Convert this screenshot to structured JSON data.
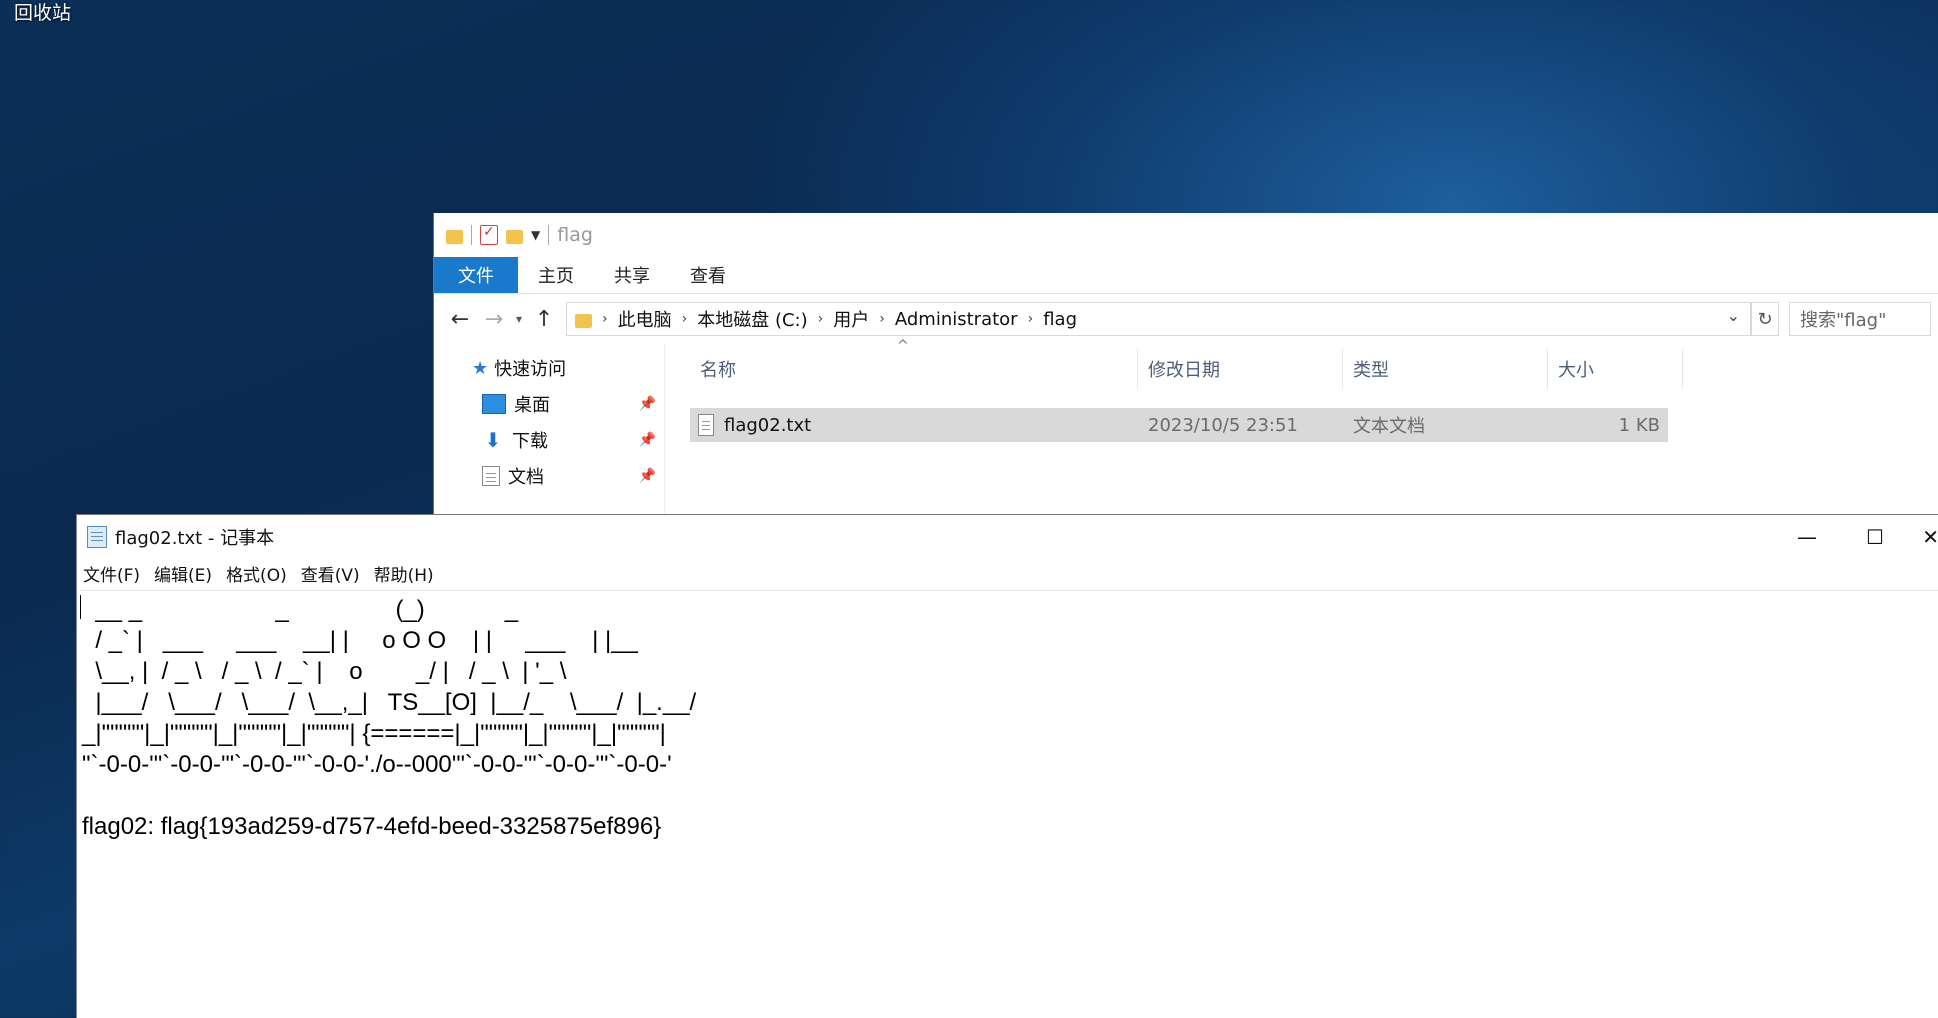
{
  "desktop": {
    "recycle_bin_label": "回收站"
  },
  "explorer": {
    "title": "flag",
    "ribbon_tabs": [
      "文件",
      "主页",
      "共享",
      "查看"
    ],
    "breadcrumbs": [
      "此电脑",
      "本地磁盘 (C:)",
      "用户",
      "Administrator",
      "flag"
    ],
    "search_placeholder": "搜索\"flag\"",
    "nav_items": [
      {
        "label": "快速访问",
        "icon": "star-icon"
      },
      {
        "label": "桌面",
        "icon": "desktop-icon"
      },
      {
        "label": "下载",
        "icon": "download-icon"
      },
      {
        "label": "文档",
        "icon": "document-icon"
      }
    ],
    "columns": [
      "名称",
      "修改日期",
      "类型",
      "大小"
    ],
    "files": [
      {
        "name": "flag02.txt",
        "modified": "2023/10/5 23:51",
        "type": "文本文档",
        "size": "1 KB"
      }
    ]
  },
  "notepad": {
    "title": "flag02.txt - 记事本",
    "menu": [
      "文件(F)",
      "编辑(E)",
      "格式(O)",
      "查看(V)",
      "帮助(H)"
    ],
    "content": "  __ _                    _                (_)            _\n  / _` |   ___     ___    __| |     o O O    | |     ___    | |__\n  \\__, |  / _ \\   / _ \\  / _` |    o        _/ |   / _ \\  | '_ \\\n  |___/   \\___/   \\___/  \\__,_|   TS__[O]  |__/_    \\___/  |_.__/\n_|\"\"\"\"\"|_|\"\"\"\"\"|_|\"\"\"\"\"|_|\"\"\"\"\"| {======|_|\"\"\"\"\"|_|\"\"\"\"\"|_|\"\"\"\"\"|\n\"`-0-0-'\"`-0-0-'\"`-0-0-'\"`-0-0-'./o--000'\"`-0-0-'\"`-0-0-'\"`-0-0-'\n\nflag02: flag{193ad259-d757-4efd-beed-3325875ef896}"
  }
}
